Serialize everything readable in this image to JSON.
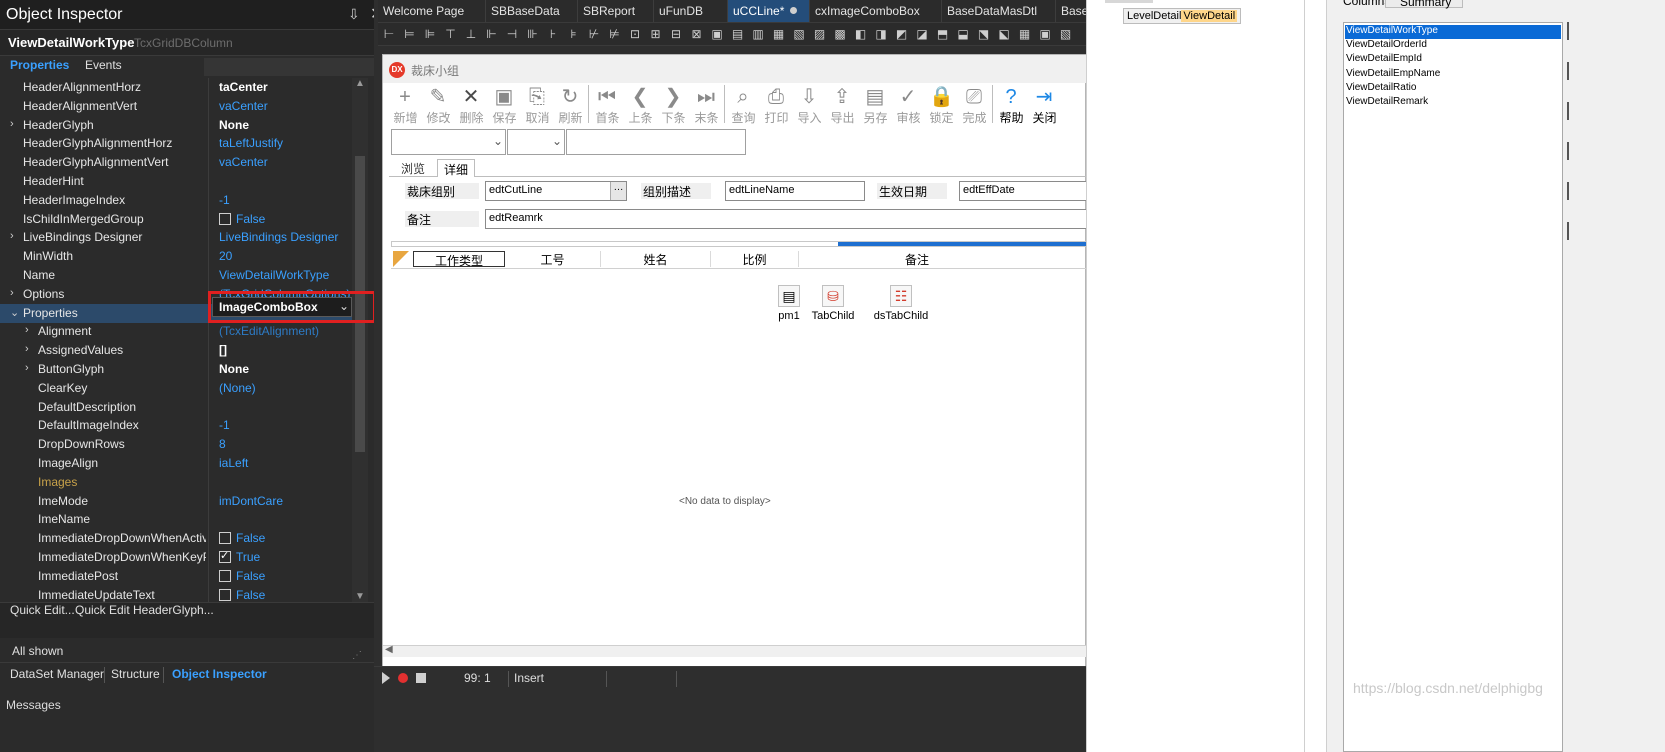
{
  "object_inspector": {
    "title": "Object Inspector",
    "pin_icon": "pin-icon",
    "component_name": "ViewDetailWorkType",
    "component_type": "TcxGridDBColumn",
    "tabs": {
      "properties": "Properties",
      "events": "Events"
    },
    "properties": [
      {
        "name": "HeaderAlignmentHorz",
        "value": "taCenter",
        "style": "bold",
        "indent": 0,
        "expand": ""
      },
      {
        "name": "HeaderAlignmentVert",
        "value": "vaCenter",
        "style": "link",
        "indent": 0,
        "expand": ""
      },
      {
        "name": "HeaderGlyph",
        "value": "None",
        "style": "bold",
        "indent": 0,
        "expand": ">"
      },
      {
        "name": "HeaderGlyphAlignmentHorz",
        "value": "taLeftJustify",
        "style": "link",
        "indent": 0,
        "expand": ""
      },
      {
        "name": "HeaderGlyphAlignmentVert",
        "value": "vaCenter",
        "style": "link",
        "indent": 0,
        "expand": ""
      },
      {
        "name": "HeaderHint",
        "value": "",
        "style": "link",
        "indent": 0,
        "expand": ""
      },
      {
        "name": "HeaderImageIndex",
        "value": "-1",
        "style": "link",
        "indent": 0,
        "expand": ""
      },
      {
        "name": "IsChildInMergedGroup",
        "value": "False",
        "style": "check",
        "checked": false,
        "indent": 0,
        "expand": ""
      },
      {
        "name": "LiveBindings Designer",
        "value": "LiveBindings Designer",
        "style": "link",
        "indent": 0,
        "expand": ">"
      },
      {
        "name": "MinWidth",
        "value": "20",
        "style": "link",
        "indent": 0,
        "expand": ""
      },
      {
        "name": "Name",
        "value": "ViewDetailWorkType",
        "style": "link",
        "indent": 0,
        "expand": ""
      },
      {
        "name": "Options",
        "value": "(TcxGridColumnOptions)",
        "style": "link",
        "indent": 0,
        "expand": ">"
      },
      {
        "name": "Properties",
        "value": "",
        "style": "combo",
        "indent": 0,
        "expand": "v"
      },
      {
        "name": "Alignment",
        "value": "(TcxEditAlignment)",
        "style": "dim",
        "indent": 1,
        "expand": ">"
      },
      {
        "name": "AssignedValues",
        "value": "[]",
        "style": "bold",
        "indent": 1,
        "expand": ">"
      },
      {
        "name": "ButtonGlyph",
        "value": "None",
        "style": "bold",
        "indent": 1,
        "expand": ">"
      },
      {
        "name": "ClearKey",
        "value": "(None)",
        "style": "link",
        "indent": 1,
        "expand": ""
      },
      {
        "name": "DefaultDescription",
        "value": "",
        "style": "link",
        "indent": 1,
        "expand": ""
      },
      {
        "name": "DefaultImageIndex",
        "value": "-1",
        "style": "link",
        "indent": 1,
        "expand": ""
      },
      {
        "name": "DropDownRows",
        "value": "8",
        "style": "link",
        "indent": 1,
        "expand": ""
      },
      {
        "name": "ImageAlign",
        "value": "iaLeft",
        "style": "link",
        "indent": 1,
        "expand": ""
      },
      {
        "name": "Images",
        "value": "",
        "style": "link",
        "indent": 1,
        "expand": "",
        "dim": true
      },
      {
        "name": "ImeMode",
        "value": "imDontCare",
        "style": "link",
        "indent": 1,
        "expand": ""
      },
      {
        "name": "ImeName",
        "value": "",
        "style": "link",
        "indent": 1,
        "expand": ""
      },
      {
        "name": "ImmediateDropDownWhenActivat",
        "value": "False",
        "style": "check",
        "checked": false,
        "indent": 1,
        "expand": ""
      },
      {
        "name": "ImmediateDropDownWhenKeyPre",
        "value": "True",
        "style": "check",
        "checked": true,
        "indent": 1,
        "expand": ""
      },
      {
        "name": "ImmediatePost",
        "value": "False",
        "style": "check",
        "checked": false,
        "indent": 1,
        "expand": ""
      },
      {
        "name": "ImmediateUpdateText",
        "value": "False",
        "style": "check",
        "checked": false,
        "indent": 1,
        "expand": ""
      }
    ],
    "properties_combo_value": "ImageComboBox",
    "quick_edit": "Quick Edit...",
    "quick_edit_glyph": "Quick Edit HeaderGlyph...",
    "filter_text": "All shown",
    "bottom_tabs": {
      "dataset_manager": "DataSet Manager",
      "structure": "Structure",
      "object_inspector": "Object Inspector"
    },
    "messages_label": "Messages"
  },
  "editor": {
    "tabs": [
      "Welcome Page",
      "SBBaseData",
      "SBReport",
      "uFunDB",
      "uCCLine*",
      "cxImageComboBox",
      "BaseDataMasDtl",
      "Base"
    ],
    "active_tab": "uCCLine*",
    "form": {
      "caption": "裁床小组",
      "logo": "DX",
      "toolbar": [
        {
          "label": "新增",
          "icon": "plus-icon",
          "glyph": "+",
          "state": "dim"
        },
        {
          "label": "修改",
          "icon": "edit-icon",
          "glyph": "✎",
          "state": "dim"
        },
        {
          "label": "删除",
          "icon": "delete-icon",
          "glyph": "✕",
          "state": "dim"
        },
        {
          "label": "保存",
          "icon": "save-icon",
          "glyph": "▣",
          "state": "dim"
        },
        {
          "label": "取消",
          "icon": "cancel-icon",
          "glyph": "⎘",
          "state": "dim"
        },
        {
          "label": "刷新",
          "icon": "refresh-icon",
          "glyph": "↻",
          "state": "dim"
        },
        {
          "label": "首条",
          "icon": "first-icon",
          "glyph": "⏮",
          "state": "dim"
        },
        {
          "label": "上条",
          "icon": "prev-icon",
          "glyph": "❮",
          "state": "dim"
        },
        {
          "label": "下条",
          "icon": "next-icon",
          "glyph": "❯",
          "state": "dim"
        },
        {
          "label": "末条",
          "icon": "last-icon",
          "glyph": "⏭",
          "state": "dim"
        },
        {
          "label": "查询",
          "icon": "search-icon",
          "glyph": "⌕",
          "state": "dim"
        },
        {
          "label": "打印",
          "icon": "print-icon",
          "glyph": "⎙",
          "state": "dim"
        },
        {
          "label": "导入",
          "icon": "import-icon",
          "glyph": "⇩",
          "state": "dim"
        },
        {
          "label": "导出",
          "icon": "export-icon",
          "glyph": "⇪",
          "state": "dim"
        },
        {
          "label": "另存",
          "icon": "save-as-icon",
          "glyph": "▤",
          "state": "dim"
        },
        {
          "label": "审核",
          "icon": "approve-icon",
          "glyph": "✓",
          "state": "dim"
        },
        {
          "label": "锁定",
          "icon": "lock-icon",
          "glyph": "🔒",
          "state": "dim"
        },
        {
          "label": "完成",
          "icon": "complete-icon",
          "glyph": "⎚",
          "state": "dim"
        },
        {
          "label": "帮助",
          "icon": "help-icon",
          "glyph": "?",
          "state": "enabled"
        },
        {
          "label": "关闭",
          "icon": "close-form-icon",
          "glyph": "⇥",
          "state": "enabled"
        }
      ],
      "page_tabs": [
        "浏览",
        "详细"
      ],
      "active_page": "详细",
      "fields": [
        {
          "label": "裁床组别",
          "edit": "edtCutLine"
        },
        {
          "label": "组别描述",
          "edit": "edtLineName"
        },
        {
          "label": "生效日期",
          "edit": "edtEffDate"
        },
        {
          "label": "备注",
          "edit": "edtReamrk"
        }
      ],
      "grid_columns": [
        "工作类型",
        "工号",
        "姓名",
        "比例",
        "备注"
      ],
      "nonvisual": [
        {
          "label": "pm1",
          "icon": "popup-menu-icon"
        },
        {
          "label": "TabChild",
          "icon": "table-icon"
        },
        {
          "label": "dsTabChild",
          "icon": "datasource-icon"
        }
      ],
      "no_data": "<No data to display>"
    },
    "status": {
      "position": "99:  1",
      "mode": "Insert"
    }
  },
  "right_pane": {
    "level_detail": "LevelDetail",
    "view_detail": "ViewDetail",
    "tabs": [
      "Columns",
      "Summary"
    ],
    "columns": [
      "ViewDetailWorkType",
      "ViewDetailOrderId",
      "ViewDetailEmpId",
      "ViewDetailEmpName",
      "ViewDetailRatio",
      "ViewDetailRemark"
    ],
    "selected_column": "ViewDetailWorkType",
    "watermark": "https://blog.csdn.net/delphigbg"
  },
  "colors": {
    "highlight": "#e02020",
    "accent": "#3aa0ff",
    "selection": "#0a6ad6"
  }
}
